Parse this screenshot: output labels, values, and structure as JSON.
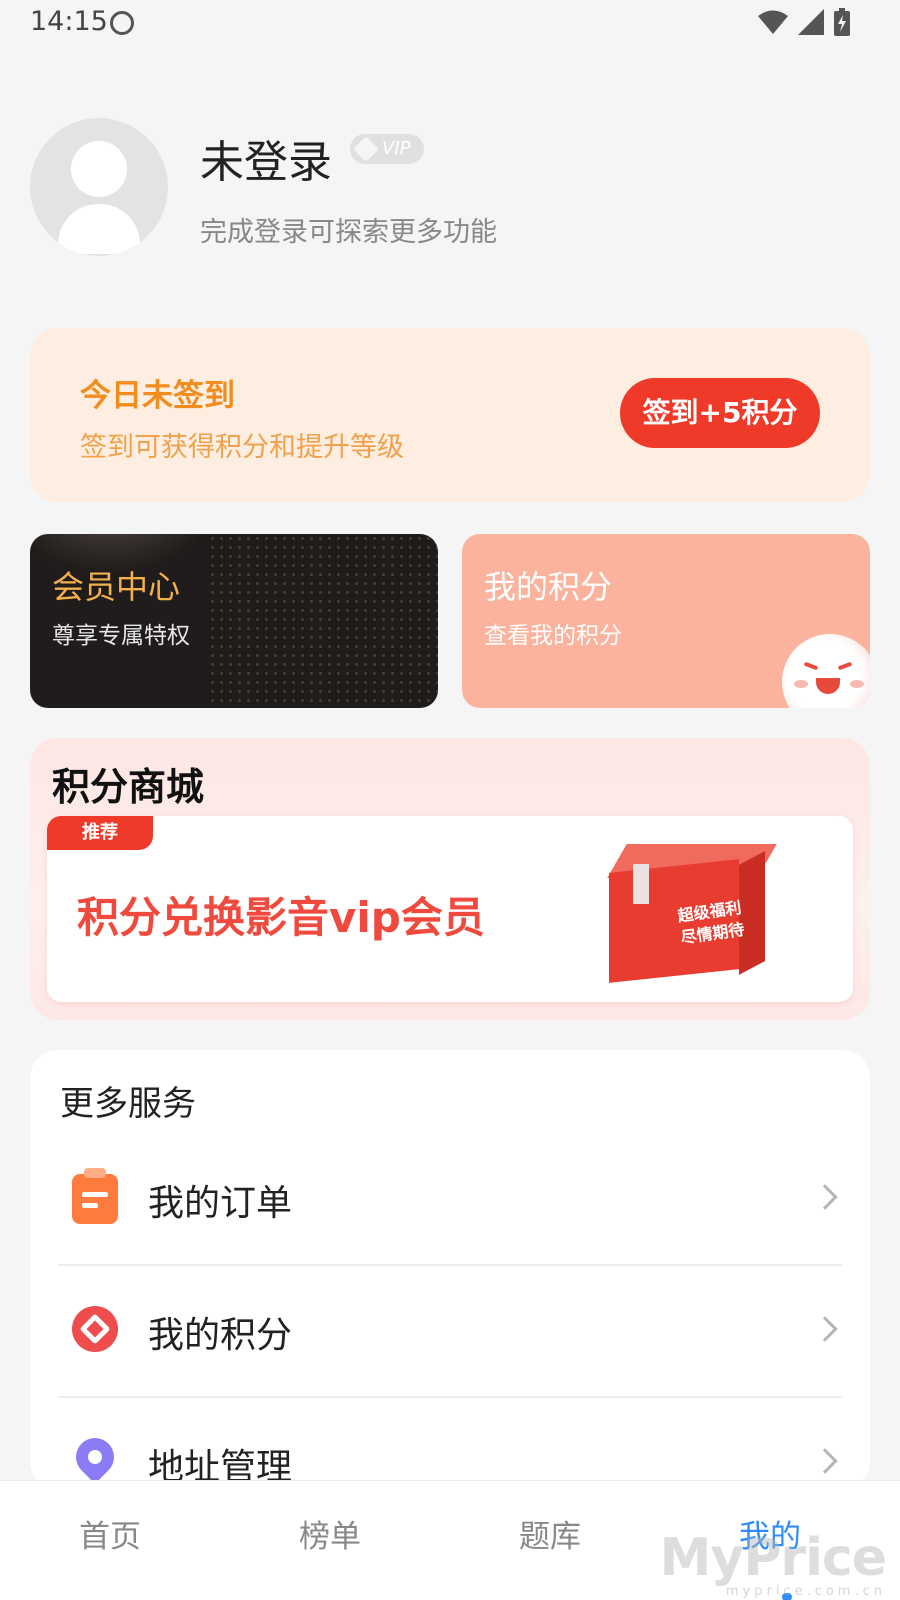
{
  "status_bar": {
    "time": "14:15",
    "icons": [
      "cat-face-icon",
      "wifi-icon",
      "signal-icon",
      "battery-charging-icon"
    ]
  },
  "profile": {
    "name": "未登录",
    "vip_badge": "VIP",
    "subtitle": "完成登录可探索更多功能"
  },
  "checkin": {
    "title": "今日未签到",
    "subtitle": "签到可获得积分和提升等级",
    "button": "签到+5积分"
  },
  "cards": {
    "member": {
      "title": "会员中心",
      "subtitle": "尊享专属特权"
    },
    "points": {
      "title": "我的积分",
      "subtitle": "查看我的积分"
    }
  },
  "mall": {
    "title": "积分商城",
    "tag": "推荐",
    "banner_text": "积分兑换影音vip会员",
    "box_text": "超级福利 尽情期待"
  },
  "services": {
    "title": "更多服务",
    "items": [
      {
        "label": "我的订单",
        "icon": "order-clipboard-icon"
      },
      {
        "label": "我的积分",
        "icon": "points-diamond-icon"
      },
      {
        "label": "地址管理",
        "icon": "location-pin-icon"
      }
    ]
  },
  "tabbar": {
    "tabs": [
      {
        "label": "首页"
      },
      {
        "label": "榜单"
      },
      {
        "label": "题库"
      },
      {
        "label": "我的"
      }
    ],
    "active": "我的"
  },
  "watermark": {
    "text": "MyPrice",
    "sub": "myprice.com.cn"
  },
  "colors": {
    "accent_red": "#ef3a2a",
    "accent_orange": "#f28c1c",
    "active_tab": "#2d8cff",
    "checkin_bg": "#fdeee1",
    "member_card_bg": "#1f1c1b",
    "points_card_bg": "#fbb39e"
  }
}
